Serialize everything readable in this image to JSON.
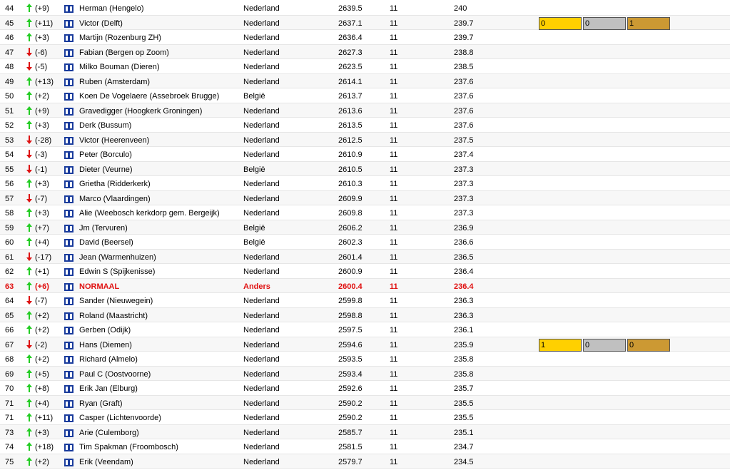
{
  "colors": {
    "up": "#22cc22",
    "down": "#dd1111",
    "highlight": "#e01010",
    "gold": "#ffd000",
    "silver": "#c0c0c0",
    "bronze": "#cc9933",
    "flag": "#1a3c9c"
  },
  "icons": {
    "up": "arrow-up-icon",
    "down": "arrow-down-icon",
    "flag": "flag-icon"
  },
  "rows": [
    {
      "rank": "44",
      "dir": "up",
      "change": "(+9)",
      "name": "Herman (Hengelo)",
      "country": "Nederland",
      "score": "2639.5",
      "rounds": "11",
      "avg": "240"
    },
    {
      "rank": "45",
      "dir": "up",
      "change": "(+11)",
      "name": "Victor (Delft)",
      "country": "Nederland",
      "score": "2637.1",
      "rounds": "11",
      "avg": "239.7",
      "medals": [
        "0",
        "0",
        "1"
      ]
    },
    {
      "rank": "46",
      "dir": "up",
      "change": "(+3)",
      "name": "Martijn (Rozenburg ZH)",
      "country": "Nederland",
      "score": "2636.4",
      "rounds": "11",
      "avg": "239.7"
    },
    {
      "rank": "47",
      "dir": "down",
      "change": "(-6)",
      "name": "Fabian (Bergen op Zoom)",
      "country": "Nederland",
      "score": "2627.3",
      "rounds": "11",
      "avg": "238.8"
    },
    {
      "rank": "48",
      "dir": "down",
      "change": "(-5)",
      "name": "Milko Bouman (Dieren)",
      "country": "Nederland",
      "score": "2623.5",
      "rounds": "11",
      "avg": "238.5"
    },
    {
      "rank": "49",
      "dir": "up",
      "change": "(+13)",
      "name": "Ruben (Amsterdam)",
      "country": "Nederland",
      "score": "2614.1",
      "rounds": "11",
      "avg": "237.6"
    },
    {
      "rank": "50",
      "dir": "up",
      "change": "(+2)",
      "name": "Koen De Vogelaere (Assebroek Brugge)",
      "country": "België",
      "score": "2613.7",
      "rounds": "11",
      "avg": "237.6"
    },
    {
      "rank": "51",
      "dir": "up",
      "change": "(+9)",
      "name": "Gravedigger (Hoogkerk Groningen)",
      "country": "Nederland",
      "score": "2613.6",
      "rounds": "11",
      "avg": "237.6"
    },
    {
      "rank": "52",
      "dir": "up",
      "change": "(+3)",
      "name": "Derk (Bussum)",
      "country": "Nederland",
      "score": "2613.5",
      "rounds": "11",
      "avg": "237.6"
    },
    {
      "rank": "53",
      "dir": "down",
      "change": "(-28)",
      "name": "Victor (Heerenveen)",
      "country": "Nederland",
      "score": "2612.5",
      "rounds": "11",
      "avg": "237.5"
    },
    {
      "rank": "54",
      "dir": "down",
      "change": "(-3)",
      "name": "Peter (Borculo)",
      "country": "Nederland",
      "score": "2610.9",
      "rounds": "11",
      "avg": "237.4"
    },
    {
      "rank": "55",
      "dir": "down",
      "change": "(-1)",
      "name": "Dieter (Veurne)",
      "country": "België",
      "score": "2610.5",
      "rounds": "11",
      "avg": "237.3"
    },
    {
      "rank": "56",
      "dir": "up",
      "change": "(+3)",
      "name": "Grietha (Ridderkerk)",
      "country": "Nederland",
      "score": "2610.3",
      "rounds": "11",
      "avg": "237.3"
    },
    {
      "rank": "57",
      "dir": "down",
      "change": "(-7)",
      "name": "Marco (Vlaardingen)",
      "country": "Nederland",
      "score": "2609.9",
      "rounds": "11",
      "avg": "237.3"
    },
    {
      "rank": "58",
      "dir": "up",
      "change": "(+3)",
      "name": "Alie (Weebosch kerkdorp gem. Bergeijk)",
      "country": "Nederland",
      "score": "2609.8",
      "rounds": "11",
      "avg": "237.3"
    },
    {
      "rank": "59",
      "dir": "up",
      "change": "(+7)",
      "name": "Jm (Tervuren)",
      "country": "België",
      "score": "2606.2",
      "rounds": "11",
      "avg": "236.9"
    },
    {
      "rank": "60",
      "dir": "up",
      "change": "(+4)",
      "name": "David (Beersel)",
      "country": "België",
      "score": "2602.3",
      "rounds": "11",
      "avg": "236.6"
    },
    {
      "rank": "61",
      "dir": "down",
      "change": "(-17)",
      "name": "Jean (Warmenhuizen)",
      "country": "Nederland",
      "score": "2601.4",
      "rounds": "11",
      "avg": "236.5"
    },
    {
      "rank": "62",
      "dir": "up",
      "change": "(+1)",
      "name": "Edwin S (Spijkenisse)",
      "country": "Nederland",
      "score": "2600.9",
      "rounds": "11",
      "avg": "236.4"
    },
    {
      "rank": "63",
      "dir": "up",
      "change": "(+6)",
      "name": "NORMAAL",
      "country": "Anders",
      "score": "2600.4",
      "rounds": "11",
      "avg": "236.4",
      "highlight": true
    },
    {
      "rank": "64",
      "dir": "down",
      "change": "(-7)",
      "name": "Sander (Nieuwegein)",
      "country": "Nederland",
      "score": "2599.8",
      "rounds": "11",
      "avg": "236.3"
    },
    {
      "rank": "65",
      "dir": "up",
      "change": "(+2)",
      "name": "Roland (Maastricht)",
      "country": "Nederland",
      "score": "2598.8",
      "rounds": "11",
      "avg": "236.3"
    },
    {
      "rank": "66",
      "dir": "up",
      "change": "(+2)",
      "name": "Gerben (Odijk)",
      "country": "Nederland",
      "score": "2597.5",
      "rounds": "11",
      "avg": "236.1"
    },
    {
      "rank": "67",
      "dir": "down",
      "change": "(-2)",
      "name": "Hans (Diemen)",
      "country": "Nederland",
      "score": "2594.6",
      "rounds": "11",
      "avg": "235.9",
      "medals": [
        "1",
        "0",
        "0"
      ]
    },
    {
      "rank": "68",
      "dir": "up",
      "change": "(+2)",
      "name": "Richard (Almelo)",
      "country": "Nederland",
      "score": "2593.5",
      "rounds": "11",
      "avg": "235.8"
    },
    {
      "rank": "69",
      "dir": "up",
      "change": "(+5)",
      "name": "Paul C (Oostvoorne)",
      "country": "Nederland",
      "score": "2593.4",
      "rounds": "11",
      "avg": "235.8"
    },
    {
      "rank": "70",
      "dir": "up",
      "change": "(+8)",
      "name": "Erik Jan (Elburg)",
      "country": "Nederland",
      "score": "2592.6",
      "rounds": "11",
      "avg": "235.7"
    },
    {
      "rank": "71",
      "dir": "up",
      "change": "(+4)",
      "name": "Ryan (Graft)",
      "country": "Nederland",
      "score": "2590.2",
      "rounds": "11",
      "avg": "235.5"
    },
    {
      "rank": "71",
      "dir": "up",
      "change": "(+11)",
      "name": "Casper (Lichtenvoorde)",
      "country": "Nederland",
      "score": "2590.2",
      "rounds": "11",
      "avg": "235.5"
    },
    {
      "rank": "73",
      "dir": "up",
      "change": "(+3)",
      "name": "Arie (Culemborg)",
      "country": "Nederland",
      "score": "2585.7",
      "rounds": "11",
      "avg": "235.1"
    },
    {
      "rank": "74",
      "dir": "up",
      "change": "(+18)",
      "name": "Tim Spakman (Froombosch)",
      "country": "Nederland",
      "score": "2581.5",
      "rounds": "11",
      "avg": "234.7"
    },
    {
      "rank": "75",
      "dir": "up",
      "change": "(+2)",
      "name": "Erik (Veendam)",
      "country": "Nederland",
      "score": "2579.7",
      "rounds": "11",
      "avg": "234.5"
    }
  ]
}
